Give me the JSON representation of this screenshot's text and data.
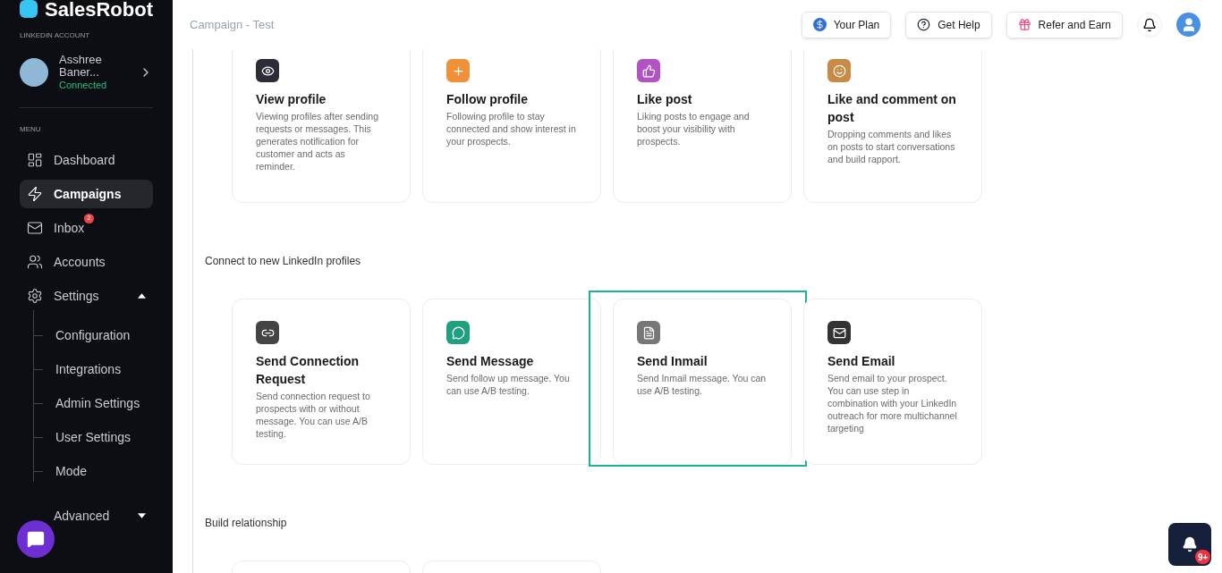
{
  "brand": "SalesRobot",
  "account": {
    "section": "LINKEDIN ACCOUNT",
    "name": "Asshree Baner...",
    "status": "Connected"
  },
  "menu": {
    "section": "MENU",
    "items": [
      {
        "kind": "dashboard",
        "label": "Dashboard",
        "selected": false
      },
      {
        "kind": "campaigns",
        "label": "Campaigns",
        "selected": true
      },
      {
        "kind": "inbox",
        "label": "Inbox",
        "selected": false,
        "badge": "2"
      },
      {
        "kind": "accounts",
        "label": "Accounts",
        "selected": false
      },
      {
        "kind": "settings",
        "label": "Settings",
        "selected": false,
        "expanded": true,
        "children": [
          {
            "label": "Configuration"
          },
          {
            "label": "Integrations"
          },
          {
            "label": "Admin Settings"
          },
          {
            "label": "User Settings"
          },
          {
            "label": "Mode"
          }
        ]
      },
      {
        "kind": "advanced",
        "label": "Advanced",
        "selected": false,
        "expanded": false
      }
    ]
  },
  "header": {
    "title": "Campaign - Test",
    "buttons": [
      {
        "kind": "plan",
        "label": "Your Plan"
      },
      {
        "kind": "help",
        "label": "Get Help"
      },
      {
        "kind": "refer",
        "label": "Refer and Earn"
      }
    ]
  },
  "sections": [
    {
      "steps": [
        {
          "kind": "eye",
          "color": "#2d2d3a",
          "title": "View profile",
          "description": "Viewing profiles after sending requests or messages. This generates notification for customer and acts as reminder.",
          "selected": false
        },
        {
          "kind": "plus",
          "color": "#f0913a",
          "title": "Follow profile",
          "description": "Following profile to stay connected and show interest in your prospects.",
          "selected": false
        },
        {
          "kind": "like",
          "color": "#b352c4",
          "title": "Like post",
          "description": "Liking posts to engage and boost your visibility with prospects.",
          "selected": false
        },
        {
          "kind": "comment",
          "color": "#c98a45",
          "title": "Like and comment on post",
          "description": "Dropping comments and likes on posts to start conversations and build rapport.",
          "selected": false
        }
      ]
    },
    {
      "title": "Connect to new LinkedIn profiles",
      "steps": [
        {
          "kind": "link",
          "color": "#444444",
          "title": "Send Connection Request",
          "description": "Send connection request to prospects with or without message. You can use A/B testing.",
          "selected": false
        },
        {
          "kind": "message",
          "color": "#1fa07f",
          "title": "Send Message",
          "description": "Send follow up message. You can use A/B testing.",
          "selected": false
        },
        {
          "kind": "inmail",
          "color": "#777777",
          "title": "Send Inmail",
          "description": "Send Inmail message. You can use A/B testing.",
          "selected": true
        },
        {
          "kind": "email",
          "color": "#333333",
          "title": "Send Email",
          "description": "Send email to your prospect. You can use step in combination with your LinkedIn outreach for more multichannel targeting",
          "selected": false
        }
      ]
    },
    {
      "title": "Build relationship",
      "steps": [
        {
          "kind": "empty"
        },
        {
          "kind": "empty"
        }
      ]
    }
  ],
  "notifications": {
    "badge": "9+"
  }
}
